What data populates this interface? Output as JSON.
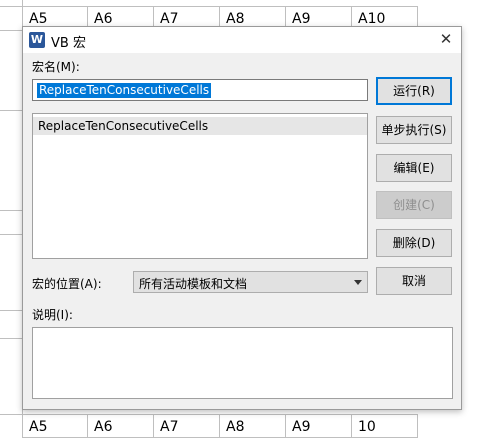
{
  "sheet": {
    "top_row": [
      "A5",
      "A6",
      "A7",
      "A8",
      "A9",
      "A10"
    ],
    "bottom_row": [
      "A5",
      "A6",
      "A7",
      "A8",
      "A9",
      "10"
    ]
  },
  "dialog": {
    "app_icon": "W",
    "title": "VB 宏",
    "macro_name_label": "宏名(M):",
    "macro_name_value": "ReplaceTenConsecutiveCells",
    "list_items": [
      "ReplaceTenConsecutiveCells"
    ],
    "buttons": {
      "run": "运行(R)",
      "step": "单步执行(S)",
      "edit": "编辑(E)",
      "create": "创建(C)",
      "delete": "删除(D)",
      "cancel": "取消"
    },
    "location_label": "宏的位置(A):",
    "location_value": "所有活动模板和文档",
    "description_label": "说明(I):"
  }
}
